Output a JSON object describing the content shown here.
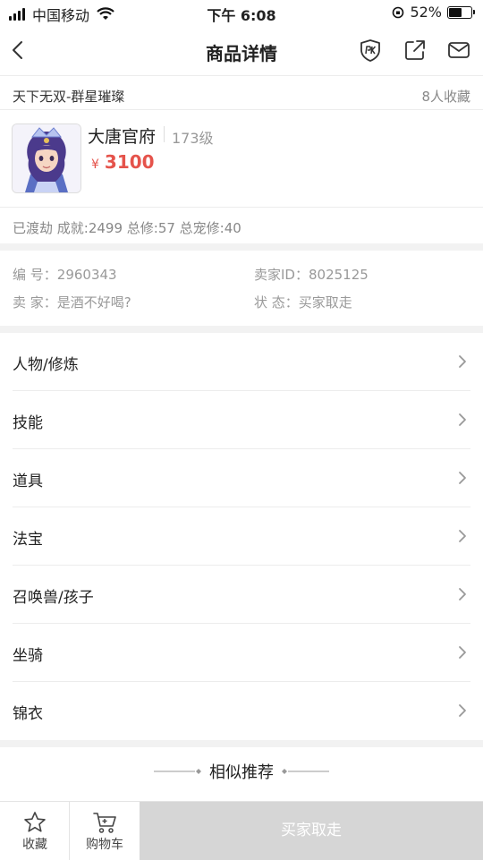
{
  "status_bar": {
    "carrier": "中国移动",
    "time": "下午 6:08",
    "battery": "52%",
    "battery_level": 0.52
  },
  "navbar": {
    "title": "商品详情",
    "icons": [
      "back-arrow-icon",
      "pk-badge-icon",
      "share-icon",
      "message-icon"
    ]
  },
  "server_header": {
    "server": "天下无双-群星璀璨",
    "favorites": "8人收藏"
  },
  "product": {
    "name": "大唐官府",
    "level": "173级",
    "currency": "¥",
    "price": "3100"
  },
  "stats": "已渡劫 成就:2499 总修:57 总宠修:40",
  "info": {
    "id_label": "编 号：",
    "id_value": "2960343",
    "seller_id_label": "卖家ID：",
    "seller_id_value": "8025125",
    "seller_label": "卖 家：",
    "seller_value": "是酒不好喝?",
    "state_label": "状 态：",
    "state_value": "买家取走"
  },
  "menu": [
    {
      "label": "人物/修炼"
    },
    {
      "label": "技能"
    },
    {
      "label": "道具"
    },
    {
      "label": "法宝"
    },
    {
      "label": "召唤兽/孩子"
    },
    {
      "label": "坐骑"
    },
    {
      "label": "锦衣"
    }
  ],
  "similar": {
    "title": "相似推荐"
  },
  "bottom_bar": {
    "favorite_label": "收藏",
    "cart_label": "购物车",
    "buy_label": "买家取走"
  },
  "colors": {
    "price": "#e5534b",
    "disabled_button": "#d6d6d6",
    "divider": "#ececec"
  }
}
